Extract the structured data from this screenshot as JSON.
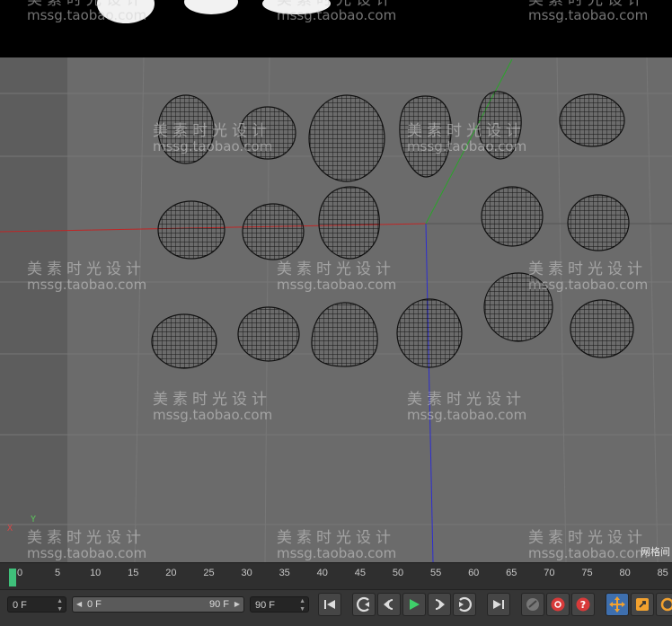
{
  "watermark": {
    "cn": "美素时光设计",
    "en": "mssg.taobao.com"
  },
  "viewport": {
    "corner_label": "网格间",
    "axis_x": "X",
    "axis_y": "Y",
    "grid_color": "#7a7a7a",
    "bg_color": "#6b6b6b",
    "x_axis_color": "#c02525",
    "y_axis_color": "#2aa42a",
    "z_axis_color": "#2d2dd0"
  },
  "timeline": {
    "ticks": [
      "0",
      "5",
      "10",
      "15",
      "20",
      "25",
      "30",
      "35",
      "40",
      "45",
      "50",
      "55",
      "60",
      "65",
      "70",
      "75",
      "80",
      "85"
    ],
    "current_frame": 0,
    "playhead_color": "#3fc07a"
  },
  "controls": {
    "current_frame_field": "0 F",
    "range_start": "0 F",
    "range_end": "90 F",
    "max_frame_field": "90 F",
    "buttons": [
      "go-to-start-icon",
      "previous-key-icon",
      "previous-frame-icon",
      "play-icon",
      "next-frame-icon",
      "next-key-icon",
      "go-to-end-icon",
      "record-keys-icon",
      "autokey-icon",
      "keyframe-selection-icon",
      "move-key-icon",
      "scale-key-icon",
      "rotate-key-icon"
    ]
  }
}
